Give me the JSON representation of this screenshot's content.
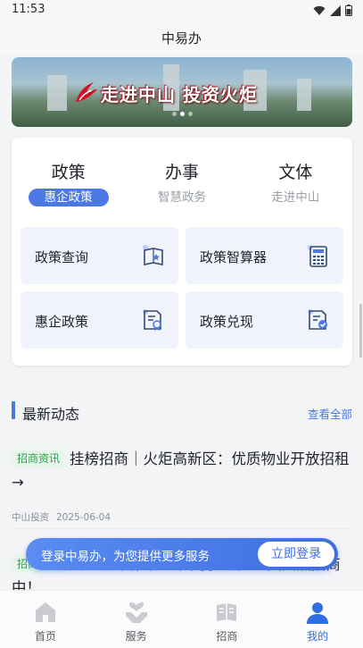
{
  "status_bar": {
    "time": "11:53",
    "icons": [
      "wifi-icon",
      "signal-icon",
      "battery-icon"
    ]
  },
  "header": {
    "title": "中易办"
  },
  "banner": {
    "headline": "走进中山 投资火炬",
    "dots": 3,
    "active_dot": 1
  },
  "service_tabs": [
    {
      "title": "政策",
      "subtitle": "惠企政策",
      "active": true
    },
    {
      "title": "办事",
      "subtitle": "智慧政务",
      "active": false
    },
    {
      "title": "文体",
      "subtitle": "走进中山",
      "active": false
    }
  ],
  "tiles": [
    {
      "label": "政策查询",
      "icon": "policy-book-icon"
    },
    {
      "label": "政策智算器",
      "icon": "calculator-icon"
    },
    {
      "label": "惠企政策",
      "icon": "document-badge-icon"
    },
    {
      "label": "政策兑现",
      "icon": "document-check-icon"
    }
  ],
  "news_section": {
    "title": "最新动态",
    "more": "查看全部"
  },
  "news": [
    {
      "tag": "招商资讯",
      "text": "挂榜招商｜火炬高新区：优质物业开放招租→",
      "source": "中山投资",
      "date": "2025-06-04"
    },
    {
      "tag": "招商资讯",
      "text": "兴达5G共性产业园等多个产业园火热招商中！"
    }
  ],
  "login_prompt": {
    "message": "登录中易办，为您提供更多服务",
    "button": "立即登录"
  },
  "tabbar": [
    {
      "label": "首页",
      "icon": "home-icon",
      "active": false
    },
    {
      "label": "服务",
      "icon": "service-hands-icon",
      "active": false
    },
    {
      "label": "招商",
      "icon": "investment-book-icon",
      "active": false
    },
    {
      "label": "我的",
      "icon": "user-icon",
      "active": true
    }
  ],
  "colors": {
    "accent": "#4b78e4",
    "tag_green": "#2aa14a",
    "tag_bg": "#e6f6ea",
    "tile_bg": "#f0f3fb"
  }
}
